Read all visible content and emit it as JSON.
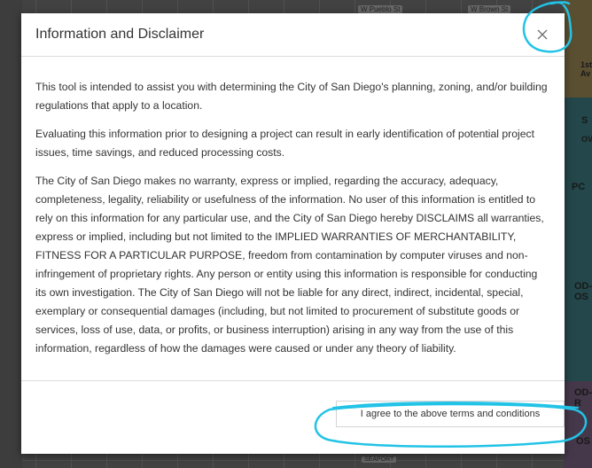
{
  "map": {
    "street_labels": [
      "W Pueblo St",
      "W Brown St"
    ],
    "side_labels": [
      "1st Av",
      "S",
      "OV",
      "PC",
      "OD-OS",
      "OD-R",
      "OS"
    ],
    "bottom_label": "SEAPORT"
  },
  "dialog": {
    "title": "Information and Disclaimer",
    "close_icon": "close-icon",
    "paragraphs": [
      "This tool is intended to assist you with determining the City of San Diego's planning, zoning, and/or building regulations that apply to a location.",
      "Evaluating this information prior to designing a project can result in early identification of potential project issues, time savings, and reduced processing costs.",
      "The City of San Diego makes no warranty, express or implied, regarding the accuracy, adequacy, completeness, legality, reliability or usefulness of the information. No user of this information is entitled to rely on this information for any particular use, and the City of San Diego hereby DISCLAIMS all warranties, express or implied, including but not limited to the IMPLIED WARRANTIES OF MERCHANTABILITY, FITNESS FOR A PARTICULAR PURPOSE, freedom from contamination by computer viruses and non-infringement of proprietary rights.  Any person or entity using this information is responsible for conducting its own investigation. The City of San Diego will not be liable for any direct, indirect, incidental, special, exemplary or consequential damages (including, but not limited to procurement of substitute goods or services, loss of use, data, or profits, or business interruption) arising in any way from the use of this information, regardless of how the damages were caused or under any theory of liability."
    ],
    "agree_label": "I agree to the above terms and conditions"
  },
  "colors": {
    "annotation": "#22c3e6"
  }
}
